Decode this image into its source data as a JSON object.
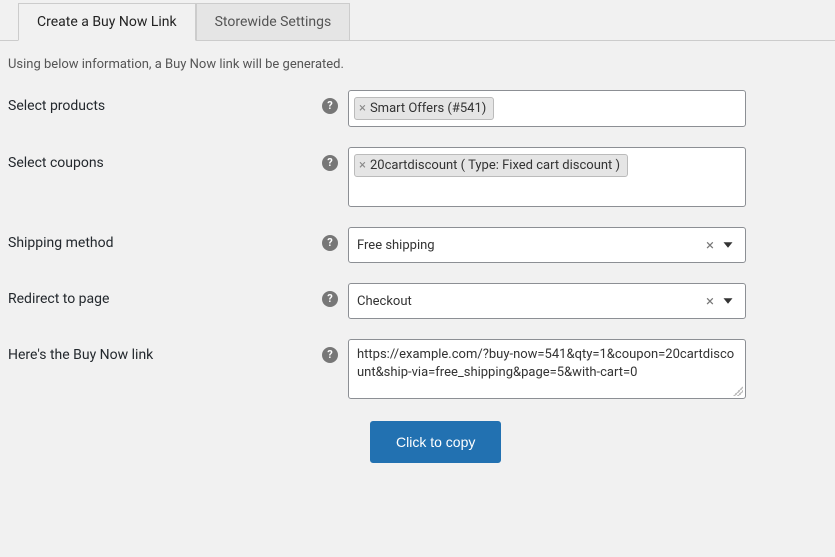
{
  "tabs": {
    "create": "Create a Buy Now Link",
    "storewide": "Storewide Settings"
  },
  "intro_text": "Using below information, a Buy Now link will be generated.",
  "fields": {
    "products": {
      "label": "Select products",
      "tags": [
        "Smart Offers (#541)"
      ]
    },
    "coupons": {
      "label": "Select coupons",
      "tags": [
        "20cartdiscount ( Type: Fixed cart discount )"
      ]
    },
    "shipping": {
      "label": "Shipping method",
      "value": "Free shipping"
    },
    "redirect": {
      "label": "Redirect to page",
      "value": "Checkout"
    },
    "link": {
      "label": "Here's the Buy Now link",
      "value": "https://example.com/?buy-now=541&qty=1&coupon=20cartdiscount&ship-via=free_shipping&page=5&with-cart=0"
    }
  },
  "buttons": {
    "copy": "Click to copy"
  },
  "glyphs": {
    "help": "?",
    "tag_x": "×",
    "clear_x": "×"
  }
}
